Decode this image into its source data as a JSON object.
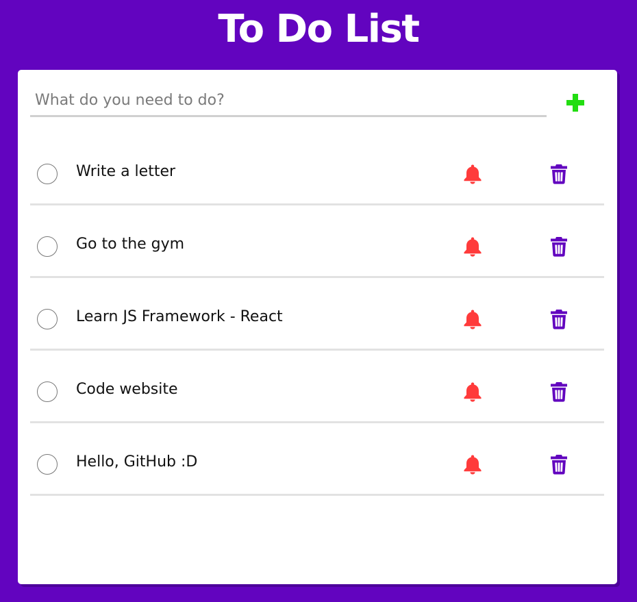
{
  "app": {
    "title": "To Do List"
  },
  "add_form": {
    "placeholder": "What do you need to do?",
    "value": "",
    "add_icon": "plus-icon"
  },
  "todos": [
    {
      "text": "Write a letter",
      "completed": false
    },
    {
      "text": "Go to the gym",
      "completed": false
    },
    {
      "text": "Learn JS Framework - React",
      "completed": false
    },
    {
      "text": "Code website",
      "completed": false
    },
    {
      "text": "Hello, GitHub :D",
      "completed": false
    }
  ],
  "icons": {
    "reminder": "bell-icon",
    "delete": "trash-icon"
  },
  "colors": {
    "background": "#6204bf",
    "card": "#ffffff",
    "add_accent": "#22dd11",
    "bell": "#ff3b3b",
    "trash": "#6204bf"
  }
}
